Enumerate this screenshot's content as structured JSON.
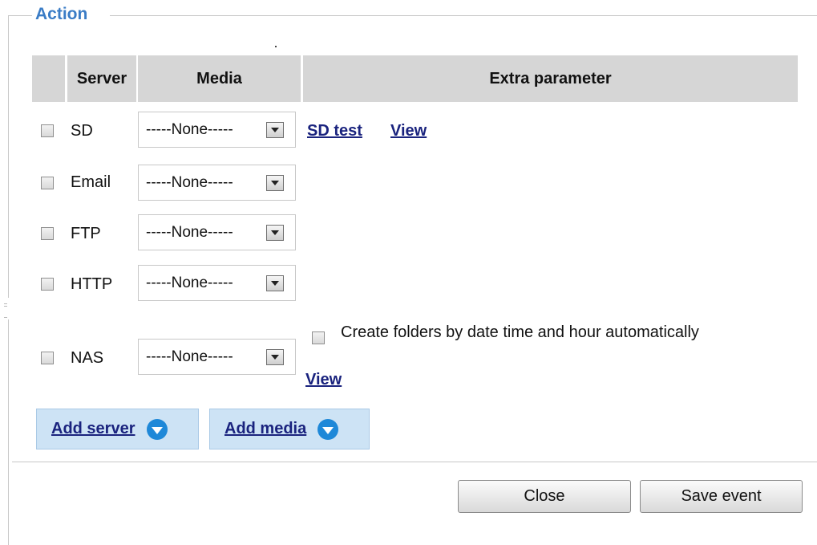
{
  "fieldset": {
    "legend": "Action"
  },
  "table": {
    "headers": {
      "server": "Server",
      "media": "Media",
      "extra": "Extra parameter"
    },
    "rows": [
      {
        "server": "SD",
        "media": "-----None-----",
        "links": [
          "SD test",
          "View"
        ]
      },
      {
        "server": "Email",
        "media": "-----None-----"
      },
      {
        "server": "FTP",
        "media": "-----None-----"
      },
      {
        "server": "HTTP",
        "media": "-----None-----"
      },
      {
        "server": "NAS",
        "media": "-----None-----",
        "option_label": "Create folders by date time and hour automatically",
        "links": [
          "View"
        ]
      }
    ]
  },
  "buttons": {
    "add_server": "Add server",
    "add_media": "Add media",
    "close": "Close",
    "save_event": "Save event"
  },
  "colors": {
    "legend": "#3a7cc6",
    "header_bg": "#d6d6d6",
    "link": "#1a237e",
    "add_button_bg": "#cde3f5",
    "add_icon": "#1e88d8"
  }
}
